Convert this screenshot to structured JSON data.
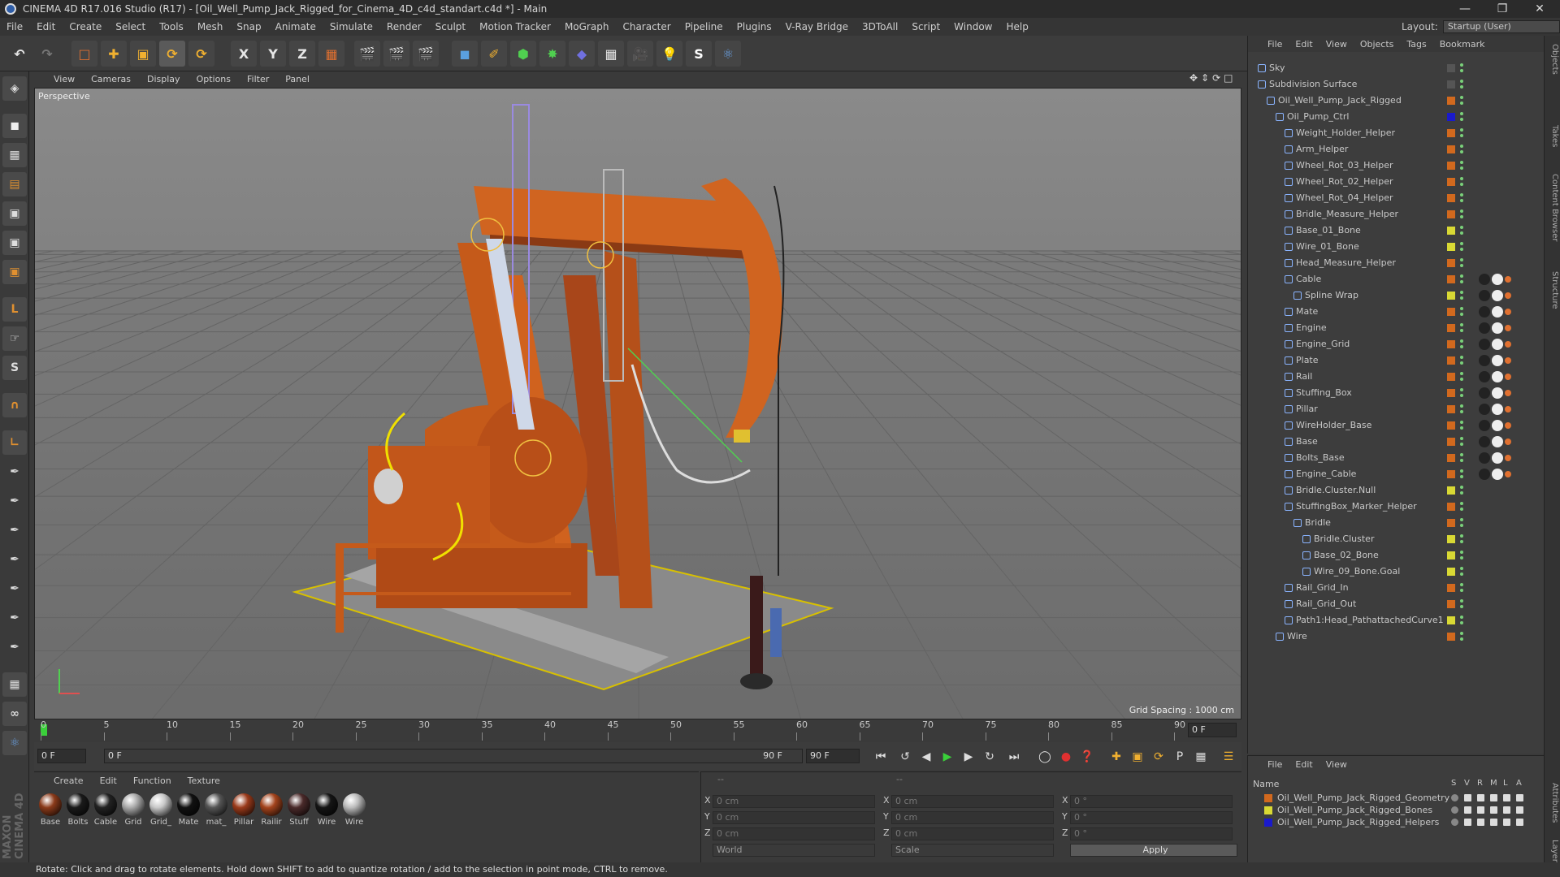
{
  "app": {
    "title": "CINEMA 4D R17.016 Studio (R17) - [Oil_Well_Pump_Jack_Rigged_for_Cinema_4D_c4d_standart.c4d *] - Main",
    "layout_label": "Layout:",
    "layout_value": "Startup (User)"
  },
  "menu": [
    "File",
    "Edit",
    "Create",
    "Select",
    "Tools",
    "Mesh",
    "Snap",
    "Animate",
    "Simulate",
    "Render",
    "Sculpt",
    "Motion Tracker",
    "MoGraph",
    "Character",
    "Pipeline",
    "Plugins",
    "V-Ray Bridge",
    "3DToAll",
    "Script",
    "Window",
    "Help"
  ],
  "viewport": {
    "menu": [
      "View",
      "Cameras",
      "Display",
      "Options",
      "Filter",
      "Panel"
    ],
    "label": "Perspective",
    "grid_spacing": "Grid Spacing : 1000 cm"
  },
  "timeline": {
    "ticks": [
      "0",
      "5",
      "10",
      "15",
      "20",
      "25",
      "30",
      "35",
      "40",
      "45",
      "50",
      "55",
      "60",
      "65",
      "70",
      "75",
      "80",
      "85",
      "90"
    ],
    "end_frame": "0 F"
  },
  "transport": {
    "current": "0 F",
    "start": "0 F",
    "end": "90 F",
    "end2": "90 F"
  },
  "materials": {
    "menu": [
      "Create",
      "Edit",
      "Function",
      "Texture"
    ],
    "items": [
      {
        "label": "Base",
        "color": "#8a3a1a"
      },
      {
        "label": "Bolts",
        "color": "#1a1a1a"
      },
      {
        "label": "Cable",
        "color": "#222222"
      },
      {
        "label": "Grid",
        "color": "#aaaaaa"
      },
      {
        "label": "Grid_",
        "color": "#c8c8c8"
      },
      {
        "label": "Mate",
        "color": "#111111"
      },
      {
        "label": "mat_",
        "color": "#555555"
      },
      {
        "label": "Pillar",
        "color": "#9a3a1a"
      },
      {
        "label": "Railir",
        "color": "#a3431c"
      },
      {
        "label": "Stuff",
        "color": "#4a2a2a"
      },
      {
        "label": "Wire",
        "color": "#151515"
      },
      {
        "label": "Wire",
        "color": "#bbbbbb"
      }
    ]
  },
  "coords": {
    "col1": [
      {
        "axis": "X",
        "value": "0 cm"
      },
      {
        "axis": "Y",
        "value": "0 cm"
      },
      {
        "axis": "Z",
        "value": "0 cm"
      }
    ],
    "col2": [
      {
        "axis": "X",
        "value": "0 cm"
      },
      {
        "axis": "Y",
        "value": "0 cm"
      },
      {
        "axis": "Z",
        "value": "0 cm"
      }
    ],
    "col3": [
      {
        "axis": "X",
        "value": "0 °"
      },
      {
        "axis": "Y",
        "value": "0 °"
      },
      {
        "axis": "Z",
        "value": "0 °"
      }
    ],
    "header1": "--",
    "header2": "--",
    "mode": "World",
    "scale": "Scale",
    "apply": "Apply"
  },
  "objects": {
    "menu": [
      "File",
      "Edit",
      "View",
      "Objects",
      "Tags",
      "Bookmark"
    ],
    "rows": [
      {
        "name": "Sky",
        "indent": 0,
        "color": "#555555"
      },
      {
        "name": "Subdivision Surface",
        "indent": 0,
        "color": "#555555"
      },
      {
        "name": "Oil_Well_Pump_Jack_Rigged",
        "indent": 1,
        "color": "#d2691e"
      },
      {
        "name": "Oil_Pump_Ctrl",
        "indent": 2,
        "color": "#1a1acc"
      },
      {
        "name": "Weight_Holder_Helper",
        "indent": 3,
        "color": "#d2691e"
      },
      {
        "name": "Arm_Helper",
        "indent": 3,
        "color": "#d2691e"
      },
      {
        "name": "Wheel_Rot_03_Helper",
        "indent": 3,
        "color": "#d2691e"
      },
      {
        "name": "Wheel_Rot_02_Helper",
        "indent": 3,
        "color": "#d2691e"
      },
      {
        "name": "Wheel_Rot_04_Helper",
        "indent": 3,
        "color": "#d2691e"
      },
      {
        "name": "Bridle_Measure_Helper",
        "indent": 3,
        "color": "#d2691e"
      },
      {
        "name": "Base_01_Bone",
        "indent": 3,
        "color": "#d9d934"
      },
      {
        "name": "Wire_01_Bone",
        "indent": 3,
        "color": "#d9d934"
      },
      {
        "name": "Head_Measure_Helper",
        "indent": 3,
        "color": "#d2691e"
      },
      {
        "name": "Cable",
        "indent": 3,
        "color": "#d2691e"
      },
      {
        "name": "Spline Wrap",
        "indent": 4,
        "color": "#d9d934"
      },
      {
        "name": "Mate",
        "indent": 3,
        "color": "#d2691e"
      },
      {
        "name": "Engine",
        "indent": 3,
        "color": "#d2691e"
      },
      {
        "name": "Engine_Grid",
        "indent": 3,
        "color": "#d2691e"
      },
      {
        "name": "Plate",
        "indent": 3,
        "color": "#d2691e"
      },
      {
        "name": "Rail",
        "indent": 3,
        "color": "#d2691e"
      },
      {
        "name": "Stuffing_Box",
        "indent": 3,
        "color": "#d2691e"
      },
      {
        "name": "Pillar",
        "indent": 3,
        "color": "#d2691e"
      },
      {
        "name": "WireHolder_Base",
        "indent": 3,
        "color": "#d2691e"
      },
      {
        "name": "Base",
        "indent": 3,
        "color": "#d2691e"
      },
      {
        "name": "Bolts_Base",
        "indent": 3,
        "color": "#d2691e"
      },
      {
        "name": "Engine_Cable",
        "indent": 3,
        "color": "#d2691e"
      },
      {
        "name": "Bridle.Cluster.Null",
        "indent": 3,
        "color": "#d9d934"
      },
      {
        "name": "StuffingBox_Marker_Helper",
        "indent": 3,
        "color": "#d2691e"
      },
      {
        "name": "Bridle",
        "indent": 4,
        "color": "#d2691e"
      },
      {
        "name": "Bridle.Cluster",
        "indent": 5,
        "color": "#d9d934"
      },
      {
        "name": "Base_02_Bone",
        "indent": 5,
        "color": "#d9d934"
      },
      {
        "name": "Wire_09_Bone.Goal",
        "indent": 5,
        "color": "#d9d934"
      },
      {
        "name": "Rail_Grid_In",
        "indent": 3,
        "color": "#d2691e"
      },
      {
        "name": "Rail_Grid_Out",
        "indent": 3,
        "color": "#d2691e"
      },
      {
        "name": "Path1:Head_PathattachedCurve1",
        "indent": 3,
        "color": "#d9d934"
      },
      {
        "name": "Wire",
        "indent": 2,
        "color": "#d2691e"
      }
    ]
  },
  "layers": {
    "menu": [
      "File",
      "Edit",
      "View"
    ],
    "name_header": "Name",
    "col_headers": [
      "S",
      "V",
      "R",
      "M",
      "L",
      "A"
    ],
    "rows": [
      {
        "name": "Oil_Well_Pump_Jack_Rigged_Geometry",
        "color": "#d2691e"
      },
      {
        "name": "Oil_Well_Pump_Jack_Rigged_Bones",
        "color": "#d9d934"
      },
      {
        "name": "Oil_Well_Pump_Jack_Rigged_Helpers",
        "color": "#1a1acc"
      }
    ]
  },
  "side_tabs": [
    "Objects",
    "Takes",
    "Content Browser",
    "Structure",
    "Attributes",
    "Layers"
  ],
  "status": "Rotate: Click and drag to rotate elements. Hold down SHIFT to add to quantize rotation / add to the selection in point mode, CTRL to remove."
}
